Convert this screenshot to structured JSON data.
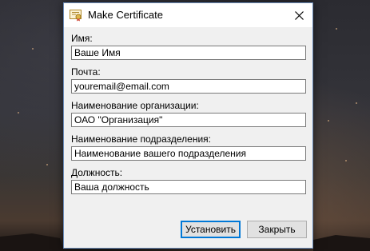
{
  "dialog": {
    "title": "Make Certificate",
    "fields": [
      {
        "label": "Имя:",
        "value": "Ваше Имя"
      },
      {
        "label": "Почта:",
        "value": "youremail@email.com"
      },
      {
        "label": "Наименование организации:",
        "value": "ОАО \"Организация\""
      },
      {
        "label": "Наименование подразделения:",
        "value": "Наименование вашего подразделения"
      },
      {
        "label": "Должность:",
        "value": "Ваша должность"
      }
    ],
    "buttons": {
      "install_label": "Установить",
      "close_label": "Закрыть"
    }
  },
  "icons": {
    "title": "certificate-icon",
    "close": "close-icon"
  },
  "colors": {
    "accent": "#0078d7",
    "dialog_bg": "#f0f0f0",
    "input_border": "#7a7a7a",
    "button_bg": "#e1e1e1"
  }
}
